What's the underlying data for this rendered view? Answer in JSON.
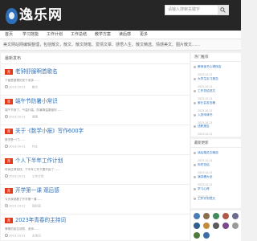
{
  "site": {
    "logo_text": "逸乐网",
    "logo_sub": "yileyi.com"
  },
  "search": {
    "placeholder": "请输入搜索关键字"
  },
  "nav": [
    {
      "label": "首页"
    },
    {
      "label": "学习技能"
    },
    {
      "label": "工作计划"
    },
    {
      "label": "工作总结"
    },
    {
      "label": "教学方案"
    },
    {
      "label": "读后感"
    },
    {
      "label": "更多"
    }
  ],
  "notice": "美文网站网编辑整理，包括散文，散文、散文随笔、爱情文章、感悟人生、散文精选、情感美文、图片散文……",
  "main": {
    "section_title": "最新发布",
    "posts": [
      {
        "tag": "荐",
        "title": "老钟舒服啊首歌名",
        "excerpt": "下面是整理的关于老钟……",
        "meta_date": "2023-10-21",
        "meta_cat": "散文"
      },
      {
        "tag": "荐",
        "title": "端午节防暑小常识",
        "excerpt": "端午节到了，气温升高，防暑降温要做好……",
        "meta_date": "2023-10-21",
        "meta_cat": "健康"
      },
      {
        "tag": "荐",
        "title": "关于《数学小报》写作600字",
        "excerpt": "数学是一门……",
        "meta_date": "2023-10-21",
        "meta_cat": "作文"
      },
      {
        "tag": "荐",
        "title": "个人下半年工作计划",
        "excerpt": "时间过得真快，下半年工作又要开始了……",
        "meta_date": "2023-10-21",
        "meta_cat": "工作计划"
      },
      {
        "tag": "荐",
        "title": "开学第一课 观后感",
        "excerpt": "今天我观看了开学第一课……",
        "meta_date": "2023-10-21",
        "meta_cat": "观后感"
      },
      {
        "tag": "荐",
        "title": "2023年青春的主持词",
        "excerpt": "尊敬的各位领导、老师……",
        "meta_date": "2023-10-21",
        "meta_cat": "主持词"
      }
    ]
  },
  "side": {
    "hot_title": "热门推荐",
    "hot_items": [
      {
        "title": "教师读书心得体会",
        "meta": "2023-10-21"
      },
      {
        "title": "大学生实习报告",
        "meta": "2023-10-21"
      },
      {
        "title": "工作总结范文",
        "meta": "2023-10-21"
      },
      {
        "title": "家长会发言稿",
        "meta": "2023-10-21"
      },
      {
        "title": "入党申请书",
        "meta": "2023-10-21"
      },
      {
        "title": "述职报告",
        "meta": "2023-10-21"
      }
    ],
    "new_title": "最新更新",
    "new_items": [
      {
        "title": "读后感范文精选",
        "meta": "2023-10-21"
      },
      {
        "title": "年终总结",
        "meta": "2023-10-21"
      },
      {
        "title": "演讲稿大全",
        "meta": "2023-10-21"
      },
      {
        "title": "学习心得",
        "meta": "2023-10-21"
      },
      {
        "title": "工作计划范文",
        "meta": "2023-10-21"
      }
    ]
  },
  "colors": {
    "accent": "#2d6fb8",
    "tag": "#e03b1c",
    "topbar": "#262626"
  }
}
